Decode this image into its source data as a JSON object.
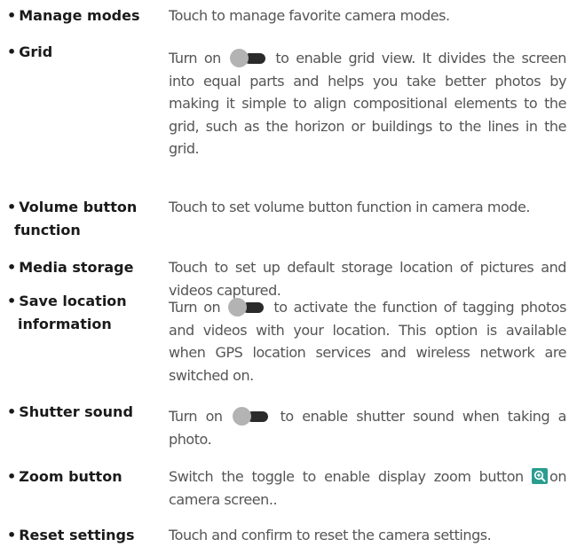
{
  "bullet": "•",
  "settings": [
    {
      "term": "Manage modes",
      "desc": "Touch to manage favorite camera modes."
    },
    {
      "term": "Grid",
      "desc_before": "Turn on",
      "desc_after": "to enable grid view. It divides the screen into equal parts and helps you take better photos by making it simple to align compositional elements to the grid, such as the horizon or buildings to the lines in the grid."
    },
    {
      "term_line1": "Volume button",
      "term_line2": "function",
      "desc": "Touch to set volume button function in camera mode."
    },
    {
      "term": "Media storage",
      "desc": "Touch to set up default storage location of pictures and videos captured."
    },
    {
      "term_line1": "Save location",
      "term_line2": "information",
      "desc_before": "Turn on",
      "desc_after": "to activate the function of tagging photos and videos with your location. This option is available when GPS location services and wireless network are switched on."
    },
    {
      "term": "Shutter sound",
      "desc_before": "Turn on",
      "desc_after": "to enable shutter sound when taking a photo."
    },
    {
      "term": "Zoom button",
      "desc_before": "Switch the toggle to enable display zoom button",
      "desc_after": "on camera screen.."
    },
    {
      "term": "Reset settings",
      "desc": "Touch and confirm to reset the camera settings."
    }
  ]
}
